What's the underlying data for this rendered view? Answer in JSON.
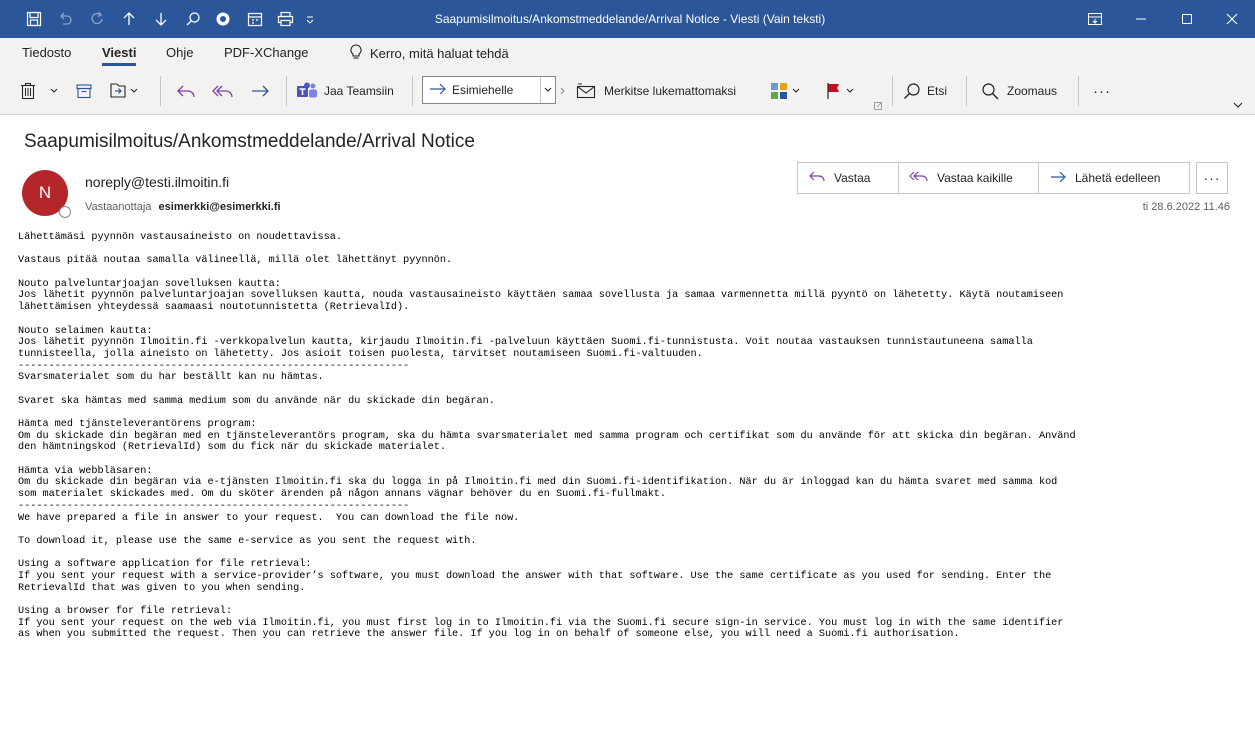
{
  "window": {
    "title": "Saapumisilmoitus/Ankomstmeddelande/Arrival Notice  -  Viesti (Vain teksti)"
  },
  "tabs": {
    "items": [
      {
        "label": "Tiedosto"
      },
      {
        "label": "Viesti"
      },
      {
        "label": "Ohje"
      },
      {
        "label": "PDF-XChange"
      }
    ],
    "active": "Viesti",
    "tell_me": "Kerro, mitä haluat tehdä"
  },
  "ribbon": {
    "share_teams": "Jaa Teamsiin",
    "quick_step": "Esimiehelle",
    "mark_unread": "Merkitse lukemattomaksi",
    "find": "Etsi",
    "zoom": "Zoomaus",
    "more": "···"
  },
  "message": {
    "subject": "Saapumisilmoitus/Ankomstmeddelande/Arrival Notice",
    "avatar_initial": "N",
    "sender": "noreply@testi.ilmoitin.fi",
    "recipient_label": "Vastaanottaja",
    "recipient": "esimerkki@esimerkki.fi",
    "date": "ti 28.6.2022 11.46",
    "actions": {
      "reply": "Vastaa",
      "reply_all": "Vastaa kaikille",
      "forward": "Lähetä edelleen",
      "more": "···"
    },
    "body_lines": [
      "Lähettämäsi pyynnön vastausaineisto on noudettavissa.",
      "",
      "Vastaus pitää noutaa samalla välineellä, millä olet lähettänyt pyynnön.",
      "",
      "Nouto palveluntarjoajan sovelluksen kautta:",
      "Jos lähetit pyynnön palveluntarjoajan sovelluksen kautta, nouda vastausaineisto käyttäen samaa sovellusta ja samaa varmennetta millä pyyntö on lähetetty. Käytä noutamiseen",
      "lähettämisen yhteydessä saamaasi noutotunnistetta (RetrievalId).",
      "",
      "Nouto selaimen kautta:",
      "Jos lähetit pyynnön Ilmoitin.fi -verkkopalvelun kautta, kirjaudu Ilmoitin.fi -palveluun käyttäen Suomi.fi-tunnistusta. Voit noutaa vastauksen tunnistautuneena samalla",
      "tunnisteella, jolla aineisto on lähetetty. Jos asioit toisen puolesta, tarvitset noutamiseen Suomi.fi-valtuuden.",
      "----------------------------------------------------------------",
      "Svarsmaterialet som du har beställt kan nu hämtas.",
      "",
      "Svaret ska hämtas med samma medium som du använde när du skickade din begäran.",
      "",
      "Hämta med tjänsteleverantörens program:",
      "Om du skickade din begäran med en tjänsteleverantörs program, ska du hämta svarsmaterialet med samma program och certifikat som du använde för att skicka din begäran. Använd",
      "den hämtningskod (RetrievalId) som du fick när du skickade materialet.",
      "",
      "Hämta via webbläsaren:",
      "Om du skickade din begäran via e-tjänsten Ilmoitin.fi ska du logga in på Ilmoitin.fi med din Suomi.fi-identifikation. När du är inloggad kan du hämta svaret med samma kod",
      "som materialet skickades med. Om du sköter ärenden på någon annans vägnar behöver du en Suomi.fi-fullmakt.",
      "----------------------------------------------------------------",
      "We have prepared a file in answer to your request.  You can download the file now.",
      "",
      "To download it, please use the same e-service as you sent the request with.",
      "",
      "Using a software application for file retrieval:",
      "If you sent your request with a service-provider’s software, you must download the answer with that software. Use the same certificate as you used for sending. Enter the",
      "RetrievalId that was given to you when sending.",
      "",
      "Using a browser for file retrieval:",
      "If you sent your request on the web via Ilmoitin.fi, you must first log in to Ilmoitin.fi via the Suomi.fi secure sign-in service. You must log in with the same identifier",
      "as when you submitted the request. Then you can retrieve the answer file. If you log in on behalf of someone else, you will need a Suomi.fi authorisation."
    ]
  },
  "colors": {
    "title_bar": "#2b579a",
    "ribbon_bg": "#f3f2f1",
    "avatar": "#b4262a",
    "accent": "#2b579a",
    "flag": "#c50f1f"
  }
}
